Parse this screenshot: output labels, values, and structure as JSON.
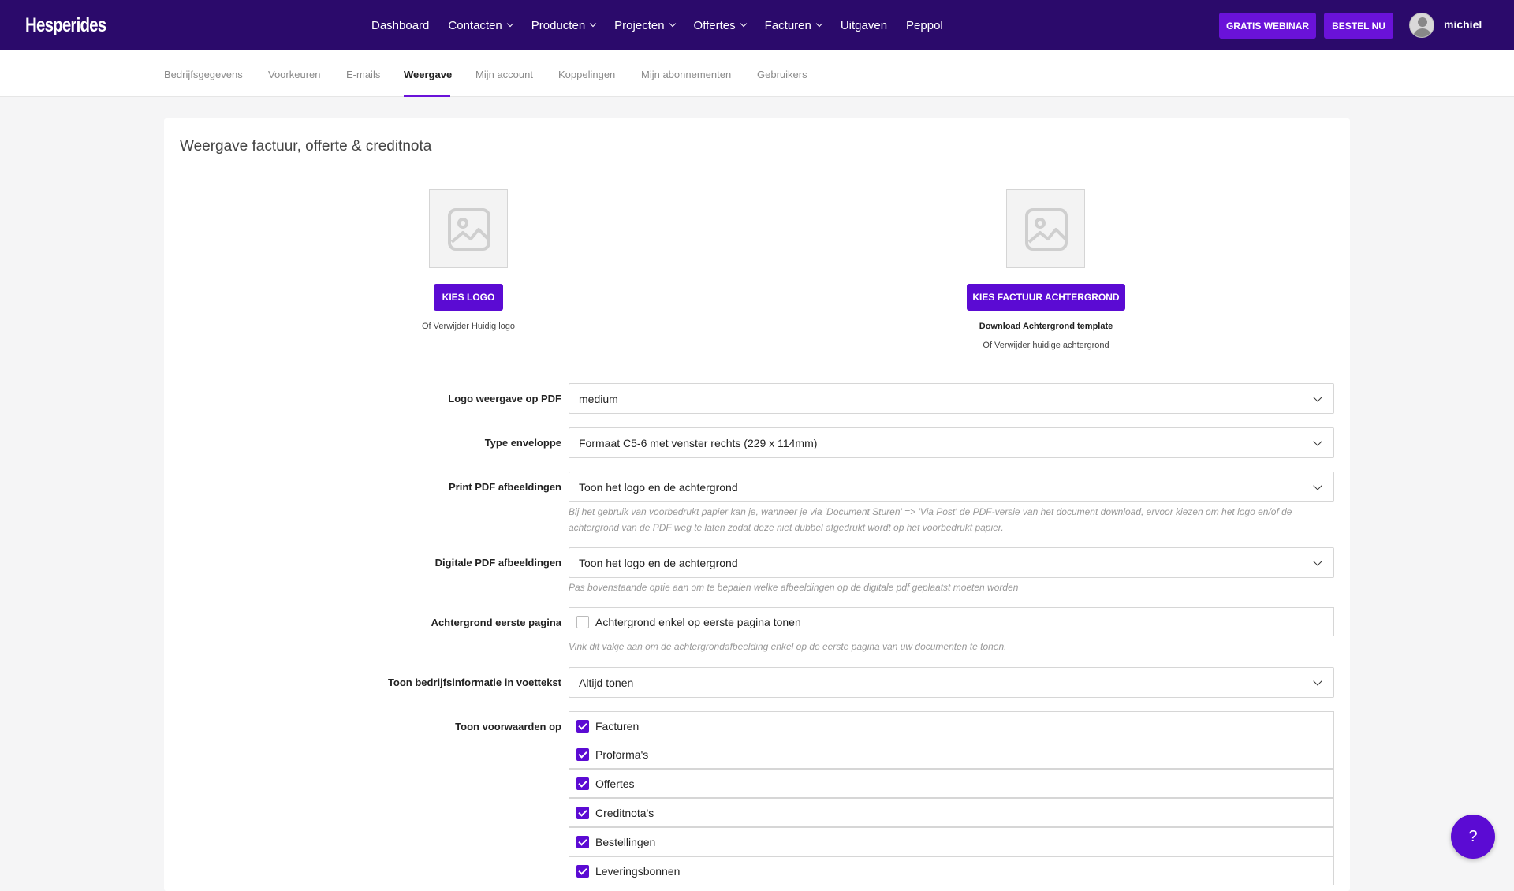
{
  "brand": {
    "name": "Hesperides"
  },
  "nav": {
    "items": [
      {
        "label": "Dashboard",
        "dropdown": false
      },
      {
        "label": "Contacten",
        "dropdown": true
      },
      {
        "label": "Producten",
        "dropdown": true
      },
      {
        "label": "Projecten",
        "dropdown": true
      },
      {
        "label": "Offertes",
        "dropdown": true
      },
      {
        "label": "Facturen",
        "dropdown": true
      },
      {
        "label": "Uitgaven",
        "dropdown": false
      },
      {
        "label": "Peppol",
        "dropdown": false
      }
    ],
    "webinar_label": "GRATIS WEBINAR",
    "order_label": "BESTEL NU",
    "username": "michiel"
  },
  "subnav": {
    "tabs": [
      {
        "label": "Bedrijfsgegevens",
        "active": false
      },
      {
        "label": "Voorkeuren",
        "active": false
      },
      {
        "label": "E-mails",
        "active": false
      },
      {
        "label": "Weergave",
        "active": true
      },
      {
        "label": "Mijn account",
        "active": false
      },
      {
        "label": "Koppelingen",
        "active": false
      },
      {
        "label": "Mijn abonnementen",
        "active": false
      },
      {
        "label": "Gebruikers",
        "active": false
      }
    ]
  },
  "card": {
    "title": "Weergave factuur, offerte & creditnota",
    "logo": {
      "button": "KIES LOGO",
      "remove": "Of Verwijder Huidig logo"
    },
    "background": {
      "button": "KIES FACTUUR ACHTERGROND",
      "download": "Download Achtergrond template",
      "remove": "Of Verwijder huidige achtergrond"
    },
    "fields": {
      "logo_display": {
        "label": "Logo weergave op PDF",
        "value": "medium"
      },
      "envelope": {
        "label": "Type enveloppe",
        "value": "Formaat C5-6 met venster rechts (229 x 114mm)"
      },
      "print_pdf": {
        "label": "Print PDF afbeeldingen",
        "value": "Toon het logo en de achtergrond",
        "help": "Bij het gebruik van voorbedrukt papier kan je, wanneer je via 'Document Sturen' => 'Via Post' de PDF-versie van het document download, ervoor kiezen om het logo en/of de achtergrond van de PDF weg te laten zodat deze niet dubbel afgedrukt wordt op het voorbedrukt papier."
      },
      "digital_pdf": {
        "label": "Digitale PDF afbeeldingen",
        "value": "Toon het logo en de achtergrond",
        "help": "Pas bovenstaande optie aan om te bepalen welke afbeeldingen op de digitale pdf geplaatst moeten worden"
      },
      "first_page_bg": {
        "label": "Achtergrond eerste pagina",
        "checkbox_label": "Achtergrond enkel op eerste pagina tonen",
        "checked": false,
        "help": "Vink dit vakje aan om de achtergrondafbeelding enkel op de eerste pagina van uw documenten te tonen."
      },
      "footer_info": {
        "label": "Toon bedrijfsinformatie in voettekst",
        "value": "Altijd tonen"
      },
      "terms_on": {
        "label": "Toon voorwaarden op",
        "options": [
          {
            "label": "Facturen",
            "checked": true
          },
          {
            "label": "Proforma's",
            "checked": true
          },
          {
            "label": "Offertes",
            "checked": true
          },
          {
            "label": "Creditnota's",
            "checked": true
          },
          {
            "label": "Bestellingen",
            "checked": true
          },
          {
            "label": "Leveringsbonnen",
            "checked": true
          }
        ]
      }
    }
  },
  "help_button": {
    "label": "?"
  },
  "colors": {
    "nav_bg": "#2b0a6b",
    "accent": "#5b0bd3",
    "page_bg": "#f5f5f6"
  }
}
